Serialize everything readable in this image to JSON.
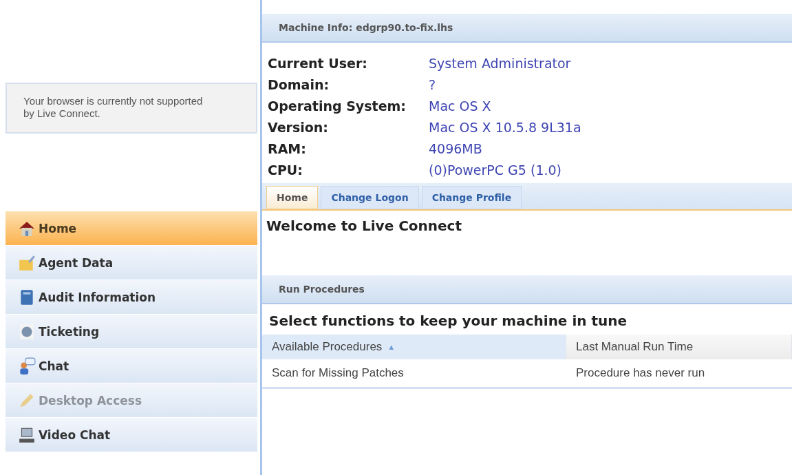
{
  "notice": "Your browser is currently not supported by Live Connect.",
  "sidebar": {
    "items": [
      {
        "label": "Home",
        "selected": true,
        "disabled": false
      },
      {
        "label": "Agent Data",
        "selected": false,
        "disabled": false
      },
      {
        "label": "Audit Information",
        "selected": false,
        "disabled": false
      },
      {
        "label": "Ticketing",
        "selected": false,
        "disabled": false
      },
      {
        "label": "Chat",
        "selected": false,
        "disabled": false
      },
      {
        "label": "Desktop Access",
        "selected": false,
        "disabled": true
      },
      {
        "label": "Video Chat",
        "selected": false,
        "disabled": false
      }
    ]
  },
  "machine_info": {
    "title": "Machine Info: edgrp90.to-fix.lhs",
    "fields": [
      {
        "label": "Current User:",
        "value": "System Administrator"
      },
      {
        "label": "Domain:",
        "value": "?"
      },
      {
        "label": "Operating System:",
        "value": "Mac OS X"
      },
      {
        "label": "Version:",
        "value": "Mac OS X 10.5.8 9L31a"
      },
      {
        "label": "RAM:",
        "value": "4096MB"
      },
      {
        "label": "CPU:",
        "value": "(0)PowerPC G5 (1.0)"
      }
    ]
  },
  "tabs": [
    {
      "label": "Home",
      "selected": true
    },
    {
      "label": "Change Logon",
      "selected": false
    },
    {
      "label": "Change Profile",
      "selected": false
    }
  ],
  "welcome": "Welcome to Live Connect",
  "run_procedures": {
    "title": "Run Procedures",
    "heading": "Select functions to keep your machine in tune",
    "columns": [
      {
        "label": "Available Procedures",
        "sort": "▲",
        "sorted": true
      },
      {
        "label": "Last Manual Run Time",
        "sorted": false
      }
    ],
    "rows": [
      [
        "Scan for Missing Patches",
        "Procedure has never run"
      ]
    ]
  }
}
